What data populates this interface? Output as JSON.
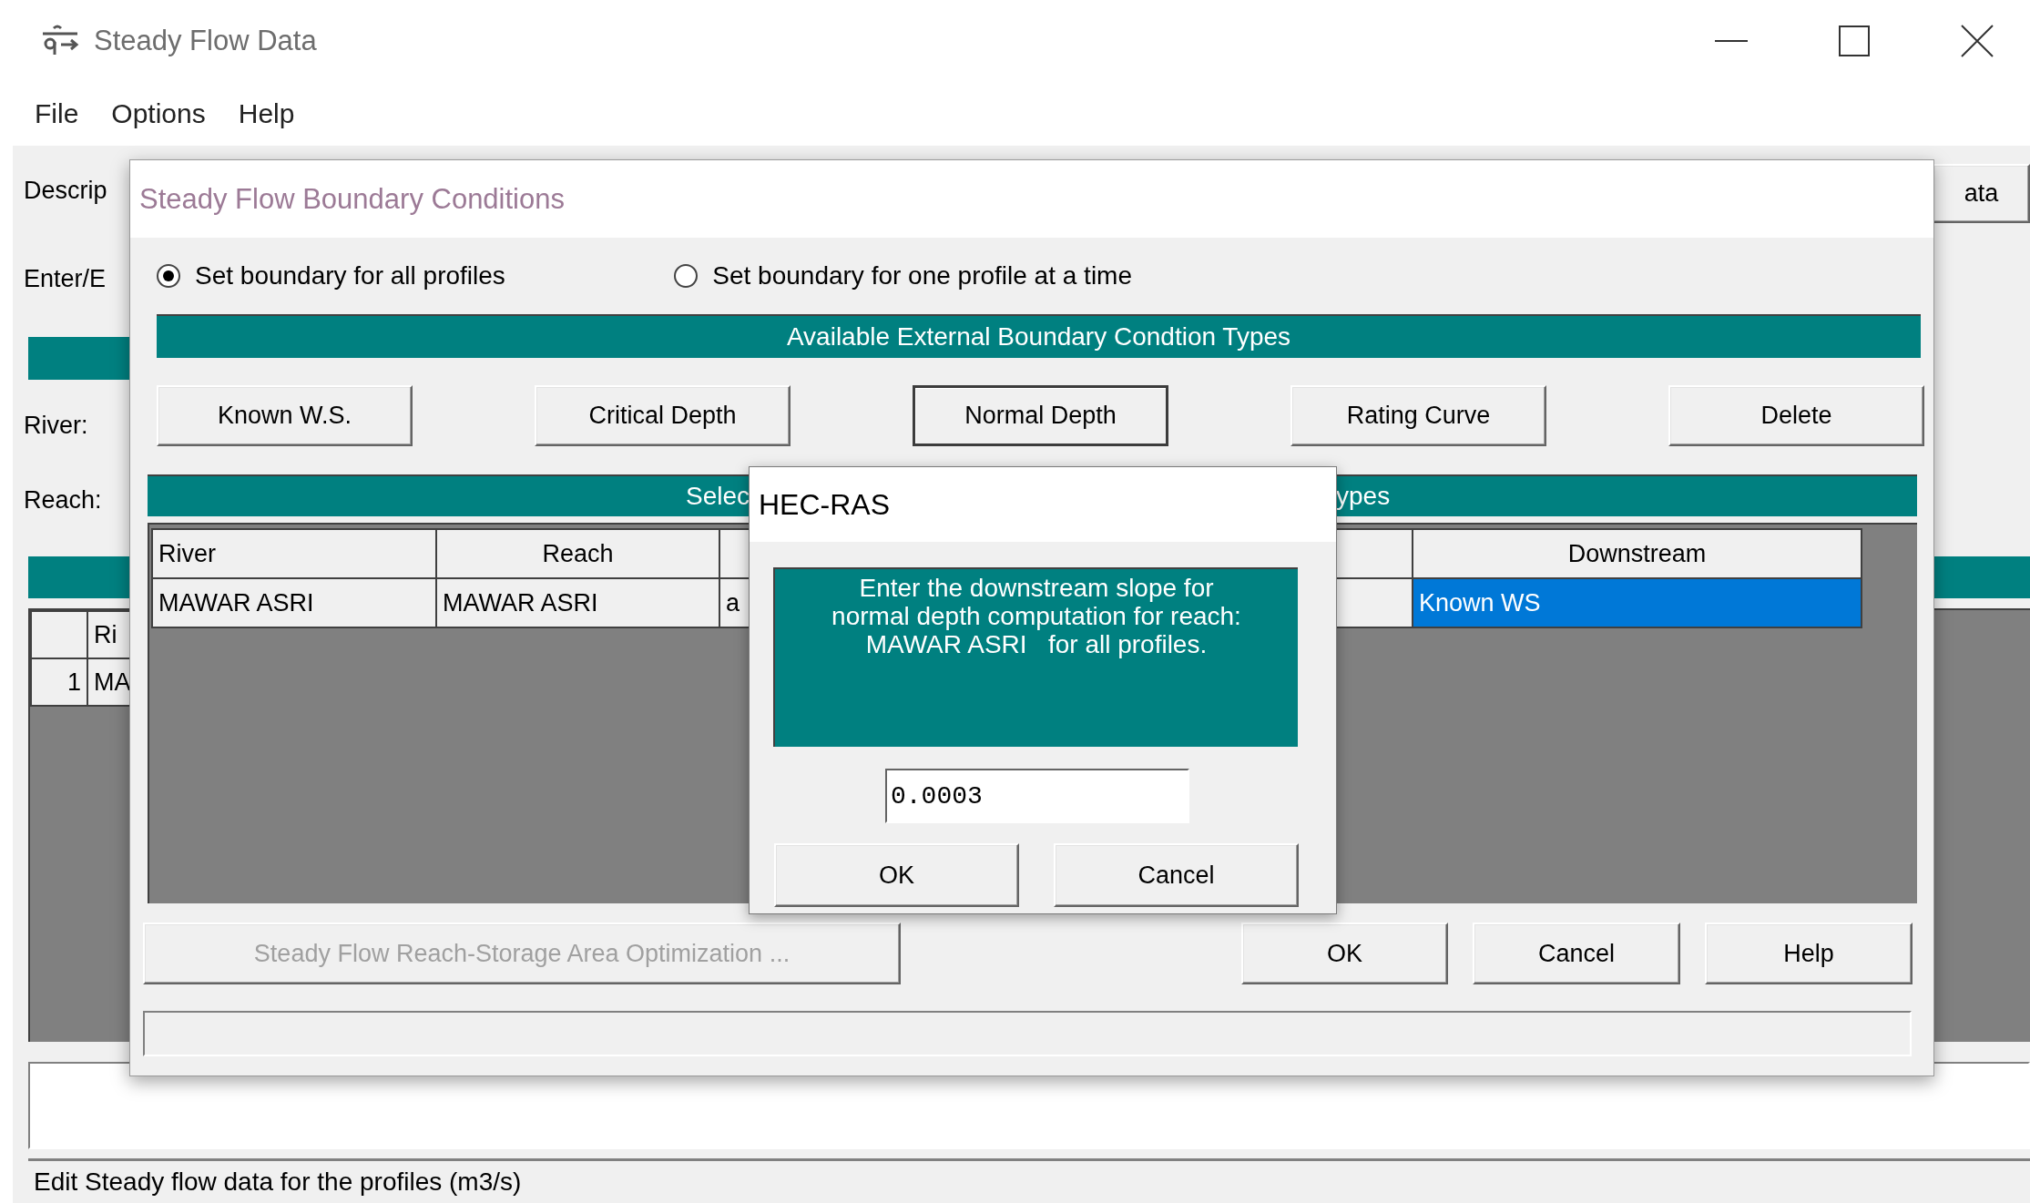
{
  "window": {
    "title": "Steady Flow Data"
  },
  "menu": [
    "File",
    "Options",
    "Help"
  ],
  "main": {
    "description_label": "Descrip",
    "enter_label": "Enter/E",
    "side_button": "ata",
    "river_label": "River:",
    "reach_label": "Reach:",
    "table": {
      "columns": [
        "Ri"
      ],
      "rows": [
        {
          "number": "1",
          "river": "MA"
        }
      ]
    }
  },
  "status_bar": "Edit Steady flow data for the profiles (m3/s)",
  "boundary_dialog": {
    "title": "Steady Flow Boundary Conditions",
    "radios": [
      {
        "label": "Set boundary for all profiles",
        "selected": true
      },
      {
        "label": "Set boundary for one profile at a time",
        "selected": false
      }
    ],
    "types_header": "Available External Boundary Condtion Types",
    "type_buttons": [
      {
        "label": "Known W.S.",
        "pressed": false
      },
      {
        "label": "Critical Depth",
        "pressed": false
      },
      {
        "label": "Normal Depth",
        "pressed": true
      },
      {
        "label": "Rating Curve",
        "pressed": false
      },
      {
        "label": "Delete",
        "pressed": false
      }
    ],
    "locations_header_left": "Selec",
    "locations_header_right": "ypes",
    "table": {
      "columns": [
        "River",
        "Reach",
        "Downstream"
      ],
      "rows": [
        {
          "river": "MAWAR ASRI",
          "reach": "MAWAR ASRI",
          "column_3": "a",
          "downstream": "Known WS",
          "downstream_selected": true
        }
      ]
    },
    "optimization_button": {
      "label": "Steady Flow Reach-Storage Area Optimization ...",
      "disabled": true
    },
    "buttons": [
      "OK",
      "Cancel",
      "Help"
    ]
  },
  "prompt": {
    "title": "HEC-RAS",
    "message": "Enter the downstream slope for normal depth computation for reach: MAWAR ASRI   for all profiles.",
    "value": "0.0003",
    "buttons": [
      "OK",
      "Cancel"
    ]
  }
}
